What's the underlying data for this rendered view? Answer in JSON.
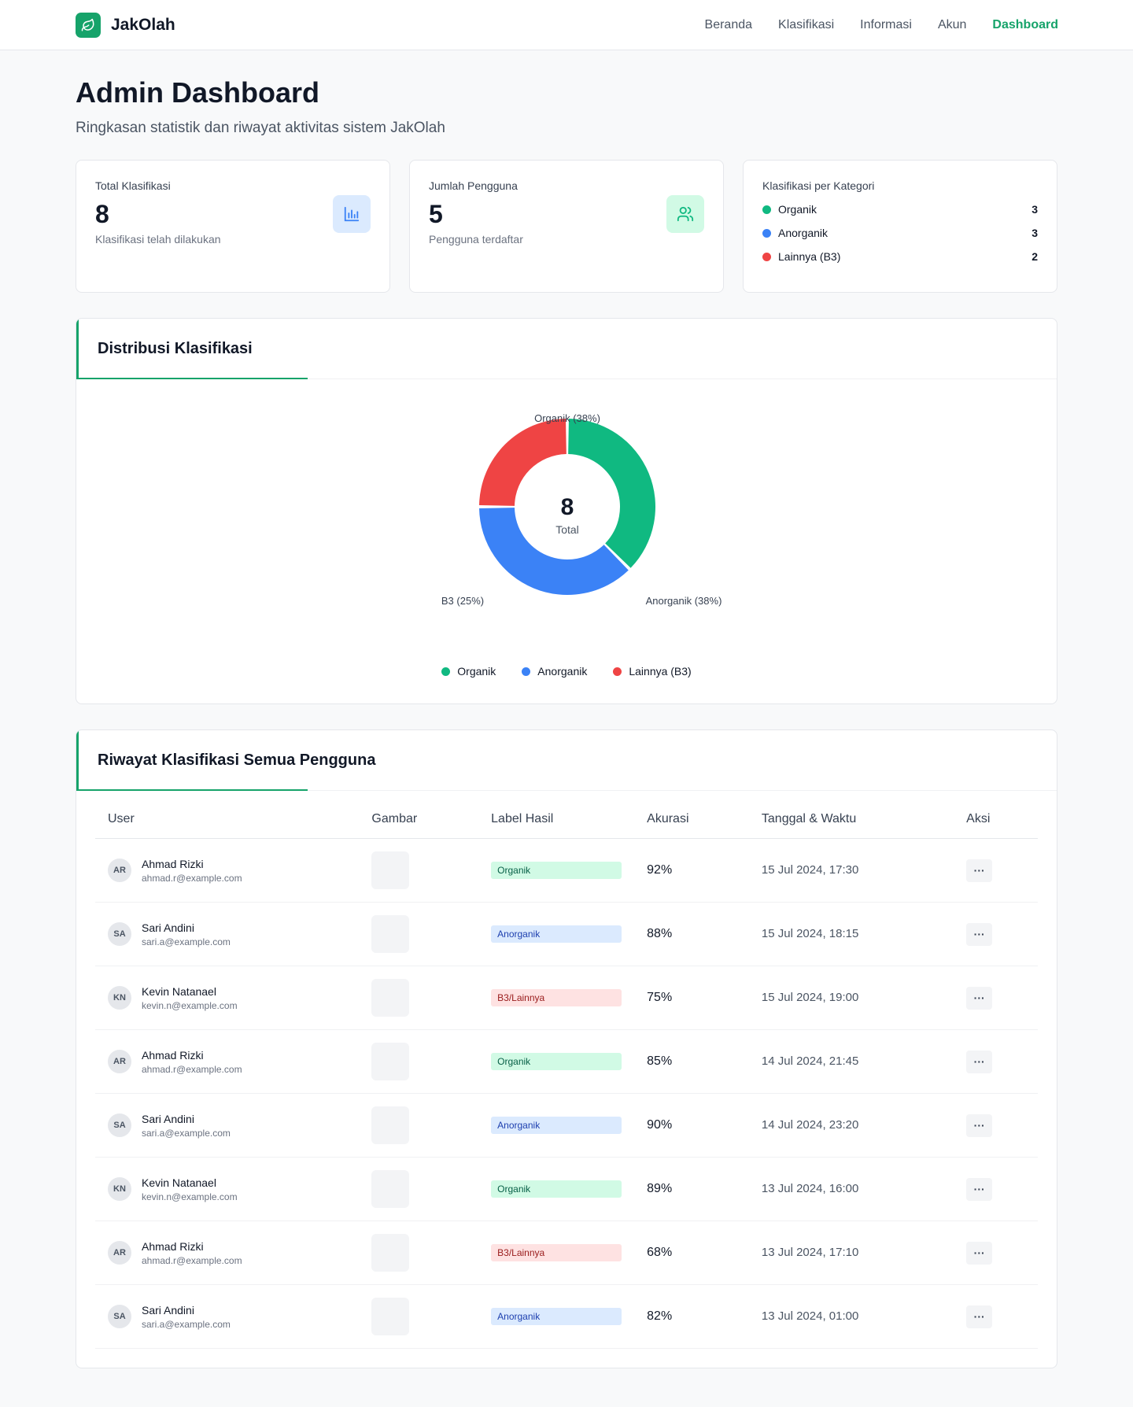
{
  "brand": {
    "name": "JakOlah",
    "logo_icon": "leaf-icon"
  },
  "nav": [
    {
      "label": "Beranda",
      "active": false
    },
    {
      "label": "Klasifikasi",
      "active": false
    },
    {
      "label": "Informasi",
      "active": false
    },
    {
      "label": "Akun",
      "active": false
    },
    {
      "label": "Dashboard",
      "active": true
    }
  ],
  "page": {
    "title": "Admin Dashboard",
    "subtitle": "Ringkasan statistik dan riwayat aktivitas sistem JakOlah"
  },
  "stats": {
    "total": {
      "label": "Total Klasifikasi",
      "value": "8",
      "desc": "Klasifikasi telah dilakukan",
      "icon": "bar-chart-icon"
    },
    "users": {
      "label": "Jumlah Pengguna",
      "value": "5",
      "desc": "Pengguna terdaftar",
      "icon": "users-icon"
    },
    "categories": {
      "label": "Klasifikasi per Kategori",
      "items": [
        {
          "name": "Organik",
          "count": "3",
          "color": "#10b981"
        },
        {
          "name": "Anorganik",
          "count": "3",
          "color": "#3b82f6"
        },
        {
          "name": "Lainnya (B3)",
          "count": "2",
          "color": "#ef4444"
        }
      ]
    }
  },
  "distribution": {
    "title": "Distribusi Klasifikasi",
    "center_value": "8",
    "center_label": "Total"
  },
  "chart_data": {
    "type": "pie",
    "categories": [
      "Organik",
      "Anorganik",
      "Lainnya (B3)"
    ],
    "values": [
      3,
      3,
      2
    ],
    "colors": [
      "#10b981",
      "#3b82f6",
      "#ef4444"
    ],
    "slice_labels": [
      "Organik (38%)",
      "Anorganik (38%)",
      "B3 (25%)"
    ],
    "center_value": "8",
    "center_label": "Total",
    "legend_position": "bottom"
  },
  "history": {
    "title": "Riwayat Klasifikasi Semua Pengguna",
    "columns": [
      "User",
      "Gambar",
      "Label Hasil",
      "Akurasi",
      "Tanggal & Waktu",
      "Aksi"
    ],
    "action_label": "···",
    "rows": [
      {
        "initials": "AR",
        "name": "Ahmad Rizki",
        "email": "ahmad.r@example.com",
        "label": "Organik",
        "type": "organik",
        "accuracy": "92%",
        "date": "15 Jul 2024, 17:30"
      },
      {
        "initials": "SA",
        "name": "Sari Andini",
        "email": "sari.a@example.com",
        "label": "Anorganik",
        "type": "anorganik",
        "accuracy": "88%",
        "date": "15 Jul 2024, 18:15"
      },
      {
        "initials": "KN",
        "name": "Kevin Natanael",
        "email": "kevin.n@example.com",
        "label": "B3/Lainnya",
        "type": "b3",
        "accuracy": "75%",
        "date": "15 Jul 2024, 19:00"
      },
      {
        "initials": "AR",
        "name": "Ahmad Rizki",
        "email": "ahmad.r@example.com",
        "label": "Organik",
        "type": "organik",
        "accuracy": "85%",
        "date": "14 Jul 2024, 21:45"
      },
      {
        "initials": "SA",
        "name": "Sari Andini",
        "email": "sari.a@example.com",
        "label": "Anorganik",
        "type": "anorganik",
        "accuracy": "90%",
        "date": "14 Jul 2024, 23:20"
      },
      {
        "initials": "KN",
        "name": "Kevin Natanael",
        "email": "kevin.n@example.com",
        "label": "Organik",
        "type": "organik",
        "accuracy": "89%",
        "date": "13 Jul 2024, 16:00"
      },
      {
        "initials": "AR",
        "name": "Ahmad Rizki",
        "email": "ahmad.r@example.com",
        "label": "B3/Lainnya",
        "type": "b3",
        "accuracy": "68%",
        "date": "13 Jul 2024, 17:10"
      },
      {
        "initials": "SA",
        "name": "Sari Andini",
        "email": "sari.a@example.com",
        "label": "Anorganik",
        "type": "anorganik",
        "accuracy": "82%",
        "date": "13 Jul 2024, 01:00"
      }
    ]
  }
}
